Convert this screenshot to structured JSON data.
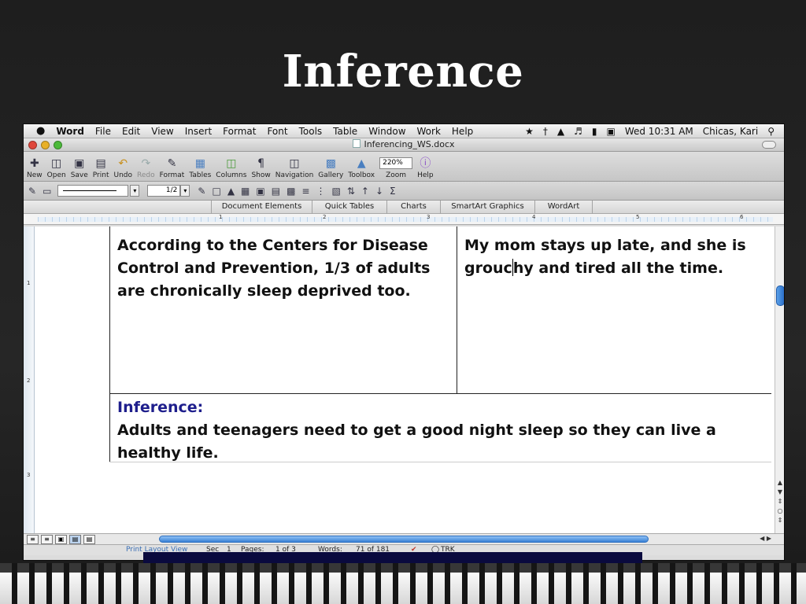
{
  "slide": {
    "title": "Inference"
  },
  "menubar": {
    "app": "Word",
    "items": [
      "File",
      "Edit",
      "View",
      "Insert",
      "Format",
      "Font",
      "Tools",
      "Table",
      "Window",
      "Work",
      "Help"
    ],
    "clock": "Wed 10:31 AM",
    "user": "Chicas, Kari"
  },
  "window": {
    "title": "Inferencing_WS.docx"
  },
  "toolbar": {
    "new": "New",
    "open": "Open",
    "save": "Save",
    "print": "Print",
    "undo": "Undo",
    "redo": "Redo",
    "format": "Format",
    "tables": "Tables",
    "columns": "Columns",
    "show": "Show",
    "navigation": "Navigation",
    "gallery": "Gallery",
    "toolbox": "Toolbox",
    "zoom": "Zoom",
    "zoom_value": "220%",
    "help": "Help"
  },
  "format_bar": {
    "line_weight": "1/2"
  },
  "ribbon": {
    "tabs": [
      "Document Elements",
      "Quick Tables",
      "Charts",
      "SmartArt Graphics",
      "WordArt"
    ]
  },
  "ruler": {
    "marks": [
      "1",
      "2",
      "3",
      "4",
      "5",
      "6"
    ]
  },
  "vruler": {
    "marks": [
      "1",
      "2",
      "3"
    ]
  },
  "document": {
    "cell_left": "According to the Centers for Disease Control and Prevention, 1/3 of adults are chronically sleep deprived too.",
    "cell_right_before_caret": "My mom stays up late, and she is grouc",
    "cell_right_after_caret": "hy and tired all the time.",
    "inference_label": "Inference:",
    "inference_text": "Adults and teenagers need to get a good night sleep so they can live a healthy life."
  },
  "status": {
    "view": "Print Layout View",
    "sec_label": "Sec",
    "sec_value": "1",
    "pages_label": "Pages:",
    "pages_value": "1 of 3",
    "words_label": "Words:",
    "words_value": "71 of 181",
    "trk": "TRK"
  },
  "colors": {
    "inference_label": "#1e1e8c",
    "scroll_accent": "#3a82d6",
    "slide_background": "#222222"
  }
}
